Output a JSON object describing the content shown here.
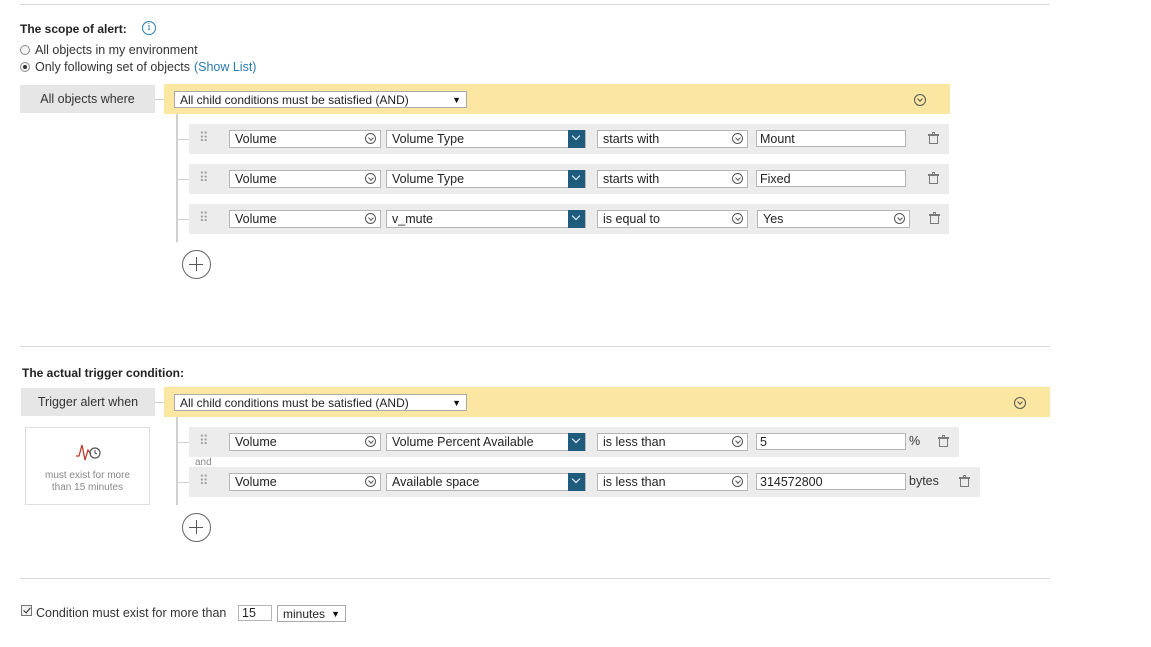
{
  "scope": {
    "title": "The scope of alert:",
    "info_icon": "info-icon",
    "option_all": "All objects in my environment",
    "option_following": "Only following set of objects",
    "show_list": "(Show List)",
    "selected_option": "following",
    "label": "All objects where",
    "group_select": "All child conditions must be satisfied (AND)",
    "conditions": [
      {
        "object": "Volume",
        "field": "Volume Type",
        "operator": "starts with",
        "value": "Mount",
        "value_type": "text"
      },
      {
        "object": "Volume",
        "field": "Volume Type",
        "operator": "starts with",
        "value": "Fixed",
        "value_type": "text"
      },
      {
        "object": "Volume",
        "field": "v_mute",
        "operator": "is equal to",
        "value": "Yes",
        "value_type": "select"
      }
    ]
  },
  "trigger": {
    "title": "The actual trigger condition:",
    "label": "Trigger alert when",
    "group_select": "All child conditions must be satisfied (AND)",
    "side_card_text": "must exist for more than 15 minutes",
    "side_card_icon": "trigger-wave-clock-icon",
    "and_label": "and",
    "conditions": [
      {
        "object": "Volume",
        "field": "Volume Percent Available",
        "operator": "is less than",
        "value": "5",
        "unit": "%"
      },
      {
        "object": "Volume",
        "field": "Available space",
        "operator": "is less than",
        "value": "314572800",
        "unit": "bytes"
      }
    ]
  },
  "footer": {
    "checkbox_checked": true,
    "label": "Condition must exist for more than",
    "duration_value": "15",
    "duration_unit": "minutes"
  }
}
